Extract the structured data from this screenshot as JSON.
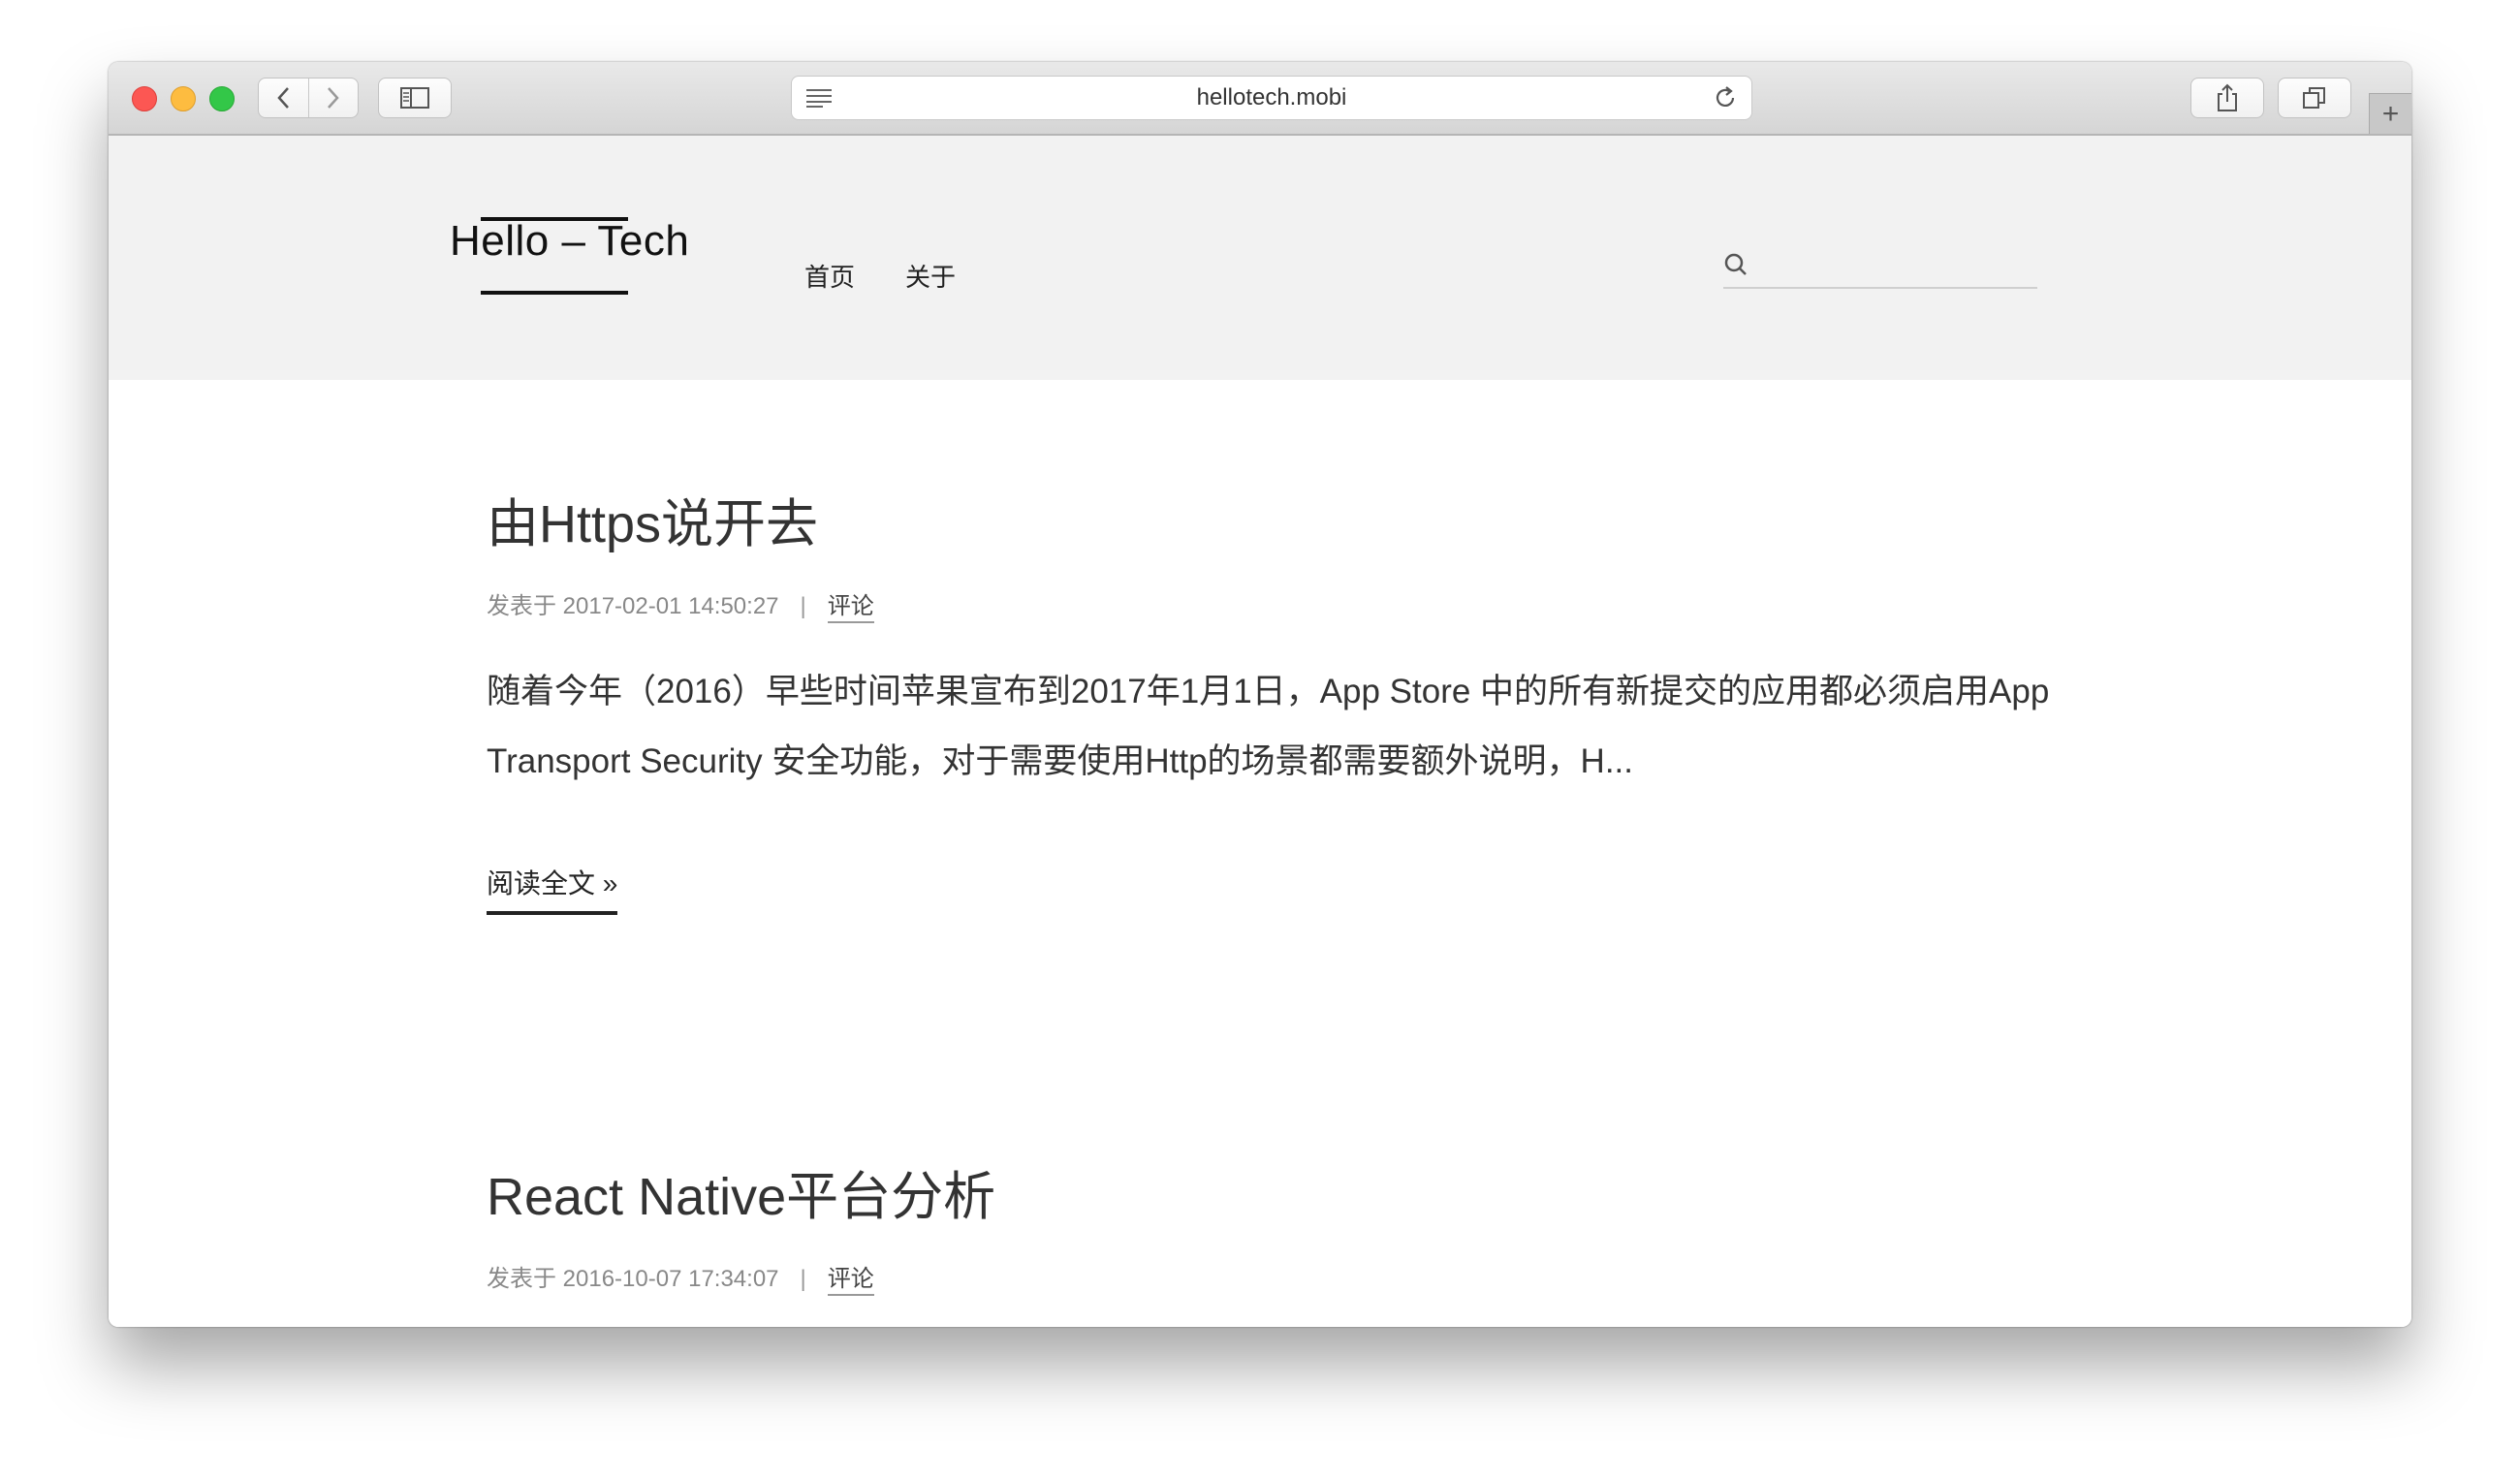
{
  "browser": {
    "url": "hellotech.mobi",
    "new_tab_label": "+"
  },
  "site": {
    "logo": "Hello – Tech",
    "nav": [
      {
        "label": "首页"
      },
      {
        "label": "关于"
      }
    ],
    "search": {
      "placeholder": "",
      "value": ""
    }
  },
  "posts": [
    {
      "title": "由Https说开去",
      "meta_prefix": "发表于 2017-02-01 14:50:27",
      "separator": "|",
      "comments_label": "评论",
      "excerpt": "随着今年（2016）早些时间苹果宣布到2017年1月1日，App Store 中的所有新提交的应用都必须启用App Transport Security 安全功能，对于需要使用Http的场景都需要额外说明，H...",
      "read_more": "阅读全文 »"
    },
    {
      "title": "React Native平台分析",
      "meta_prefix": "发表于 2016-10-07 17:34:07",
      "separator": "|",
      "comments_label": "评论"
    }
  ]
}
